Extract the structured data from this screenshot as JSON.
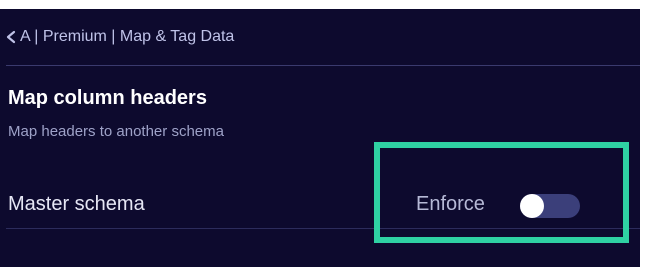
{
  "header": {
    "breadcrumb": "A | Premium | Map & Tag Data"
  },
  "section": {
    "title": "Map column headers",
    "subtitle": "Map headers to another schema"
  },
  "setting": {
    "label": "Master schema",
    "toggle_label": "Enforce",
    "toggle_on": false
  },
  "annotation": {
    "highlight_color": "#2fd1a3"
  },
  "icons": {
    "back": "chevron-left-icon"
  }
}
